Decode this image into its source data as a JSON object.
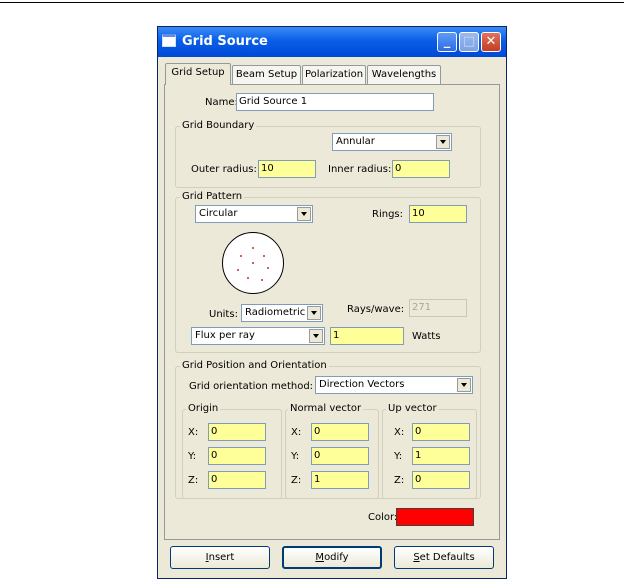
{
  "window": {
    "title": "Grid Source"
  },
  "tabs": [
    "Grid Setup",
    "Beam Setup",
    "Polarization",
    "Wavelengths"
  ],
  "name": {
    "label": "Name:",
    "value": "Grid Source 1"
  },
  "boundary": {
    "title": "Grid Boundary",
    "type": "Annular",
    "outer_label": "Outer radius:",
    "outer_value": "10",
    "inner_label": "Inner radius:",
    "inner_value": "0"
  },
  "pattern": {
    "title": "Grid Pattern",
    "type": "Circular",
    "rings_label": "Rings:",
    "rings_value": "10",
    "units_label": "Units:",
    "units_value": "Radiometric",
    "rays_label": "Rays/wave:",
    "rays_value": "271",
    "flux_type": "Flux per ray",
    "flux_value": "1",
    "flux_unit": "Watts"
  },
  "position": {
    "title": "Grid Position and Orientation",
    "method_label": "Grid orientation method:",
    "method_value": "Direction Vectors",
    "origin": {
      "title": "Origin",
      "x": "0",
      "y": "0",
      "z": "0"
    },
    "normal": {
      "title": "Normal vector",
      "x": "0",
      "y": "0",
      "z": "1"
    },
    "up": {
      "title": "Up vector",
      "x": "0",
      "y": "1",
      "z": "0"
    },
    "x_label": "X:",
    "y_label": "Y:",
    "z_label": "Z:"
  },
  "color": {
    "label": "Color:",
    "value": "#ff0000"
  },
  "buttons": {
    "insert_key": "I",
    "insert_rest": "nsert",
    "modify_key": "M",
    "modify_rest": "odify",
    "defaults_key": "S",
    "defaults_rest": "et Defaults"
  }
}
